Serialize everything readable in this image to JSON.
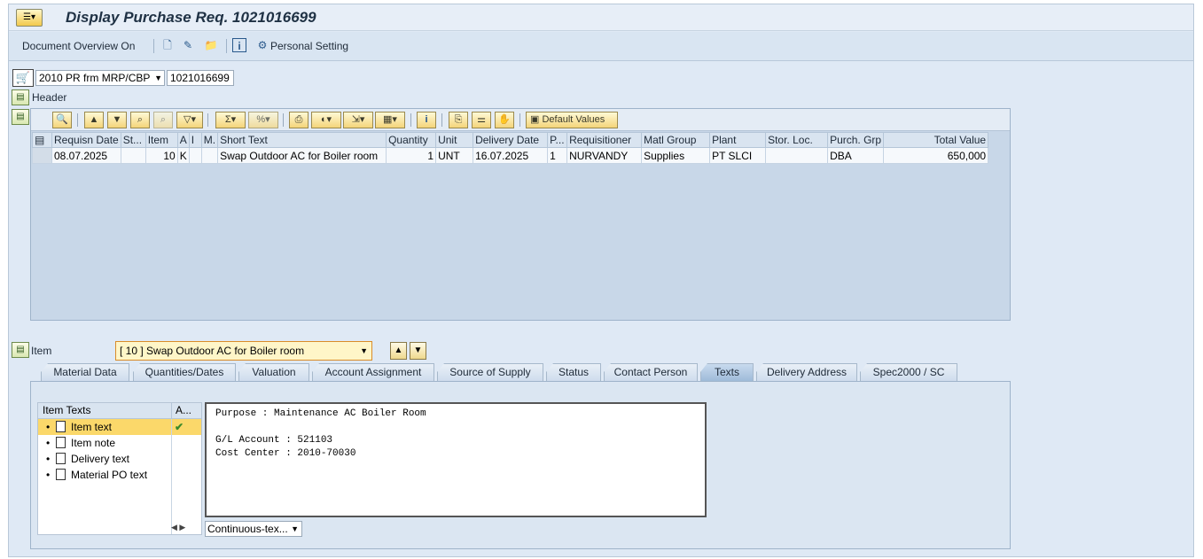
{
  "window": {
    "title": "Display Purchase Req. 1021016699"
  },
  "toolbar": {
    "doc_overview": "Document Overview On",
    "personal_setting": "Personal Setting"
  },
  "doc_selector": {
    "type": "2010 PR frm MRP/CBP",
    "number": "1021016699"
  },
  "header_label": "Header",
  "grid": {
    "default_values": "Default Values",
    "columns": [
      "Requisn Date",
      "St...",
      "Item",
      "A",
      "I",
      "M.",
      "Short Text",
      "Quantity",
      "Unit",
      "Delivery Date",
      "P...",
      "Requisitioner",
      "Matl Group",
      "Plant",
      "Stor. Loc.",
      "Purch. Grp",
      "Total Value"
    ],
    "rows": [
      [
        "08.07.2025",
        "",
        "10",
        "K",
        "",
        "",
        "Swap Outdoor AC for Boiler room",
        "1",
        "UNT",
        "16.07.2025",
        "1",
        "NURVANDY",
        "Supplies",
        "PT SLCI",
        "",
        "DBA",
        "650,000"
      ]
    ]
  },
  "item_section": {
    "label": "Item",
    "selected": "[ 10 ] Swap Outdoor AC for Boiler room"
  },
  "tabs": [
    "Material Data",
    "Quantities/Dates",
    "Valuation",
    "Account Assignment",
    "Source of Supply",
    "Status",
    "Contact Person",
    "Texts",
    "Delivery Address",
    "Spec2000 / SC"
  ],
  "active_tab": "Texts",
  "texts": {
    "tree_header": "Item Texts",
    "col_header": "A...",
    "items": [
      "Item text",
      "Item note",
      "Delivery text",
      "Material PO text"
    ],
    "editor_content": "Purpose : Maintenance AC Boiler Room\n\nG/L Account : 521103\nCost Center : 2010-70030",
    "mode": "Continuous-tex..."
  }
}
